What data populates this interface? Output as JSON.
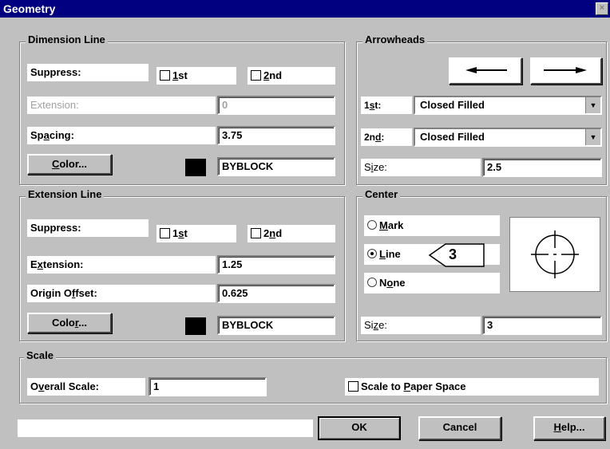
{
  "window": {
    "title": "Geometry"
  },
  "dimension_line": {
    "group_label": "Dimension Line",
    "suppress_label": "Suppress:",
    "suppress_first": {
      "pre": "",
      "key": "1",
      "post": "st",
      "checked": false
    },
    "suppress_second": {
      "pre": "",
      "key": "2",
      "post": "nd",
      "checked": false
    },
    "extension_label": "Extension:",
    "extension_value": "0",
    "spacing_label": {
      "pre": "Sp",
      "key": "a",
      "post": "cing:"
    },
    "spacing_value": "3.75",
    "color_button": {
      "pre": "",
      "key": "C",
      "post": "olor..."
    },
    "color_value": "BYBLOCK"
  },
  "arrowheads": {
    "group_label": "Arrowheads",
    "first_label": {
      "pre": "1",
      "key": "s",
      "post": "t:"
    },
    "first_value": "Closed Filled",
    "second_label": {
      "pre": "2n",
      "key": "d",
      "post": ":"
    },
    "second_value": "Closed Filled",
    "size_label": {
      "pre": "S",
      "key": "i",
      "post": "ze:"
    },
    "size_value": "2.5"
  },
  "extension_line": {
    "group_label": "Extension Line",
    "suppress_label": "Suppress:",
    "suppress_first": {
      "pre": "1",
      "key": "s",
      "post": "t",
      "checked": false
    },
    "suppress_second": {
      "pre": "2",
      "key": "n",
      "post": "d",
      "checked": false
    },
    "extension_label": {
      "pre": "E",
      "key": "x",
      "post": "tension:"
    },
    "extension_value": "1.25",
    "origin_label": {
      "pre": "Origin O",
      "key": "f",
      "post": "fset:"
    },
    "origin_value": "0.625",
    "color_button": {
      "pre": "Colo",
      "key": "r",
      "post": "..."
    },
    "color_value": "BYBLOCK"
  },
  "center": {
    "group_label": "Center",
    "mark": {
      "pre": "",
      "key": "M",
      "post": "ark",
      "selected": false
    },
    "line": {
      "pre": "",
      "key": "L",
      "post": "ine",
      "selected": true
    },
    "none": {
      "pre": "N",
      "key": "o",
      "post": "ne",
      "selected": false
    },
    "callout": "3",
    "size_label": {
      "pre": "Si",
      "key": "z",
      "post": "e:"
    },
    "size_value": "3"
  },
  "scale": {
    "group_label": "Scale",
    "overall_label": {
      "pre": "O",
      "key": "v",
      "post": "erall Scale:"
    },
    "overall_value": "1",
    "paper_space": {
      "pre": "Scale to ",
      "key": "P",
      "post": "aper Space",
      "checked": false
    }
  },
  "buttons": {
    "ok": "OK",
    "cancel": "Cancel",
    "help": {
      "pre": "",
      "key": "H",
      "post": "elp..."
    }
  }
}
